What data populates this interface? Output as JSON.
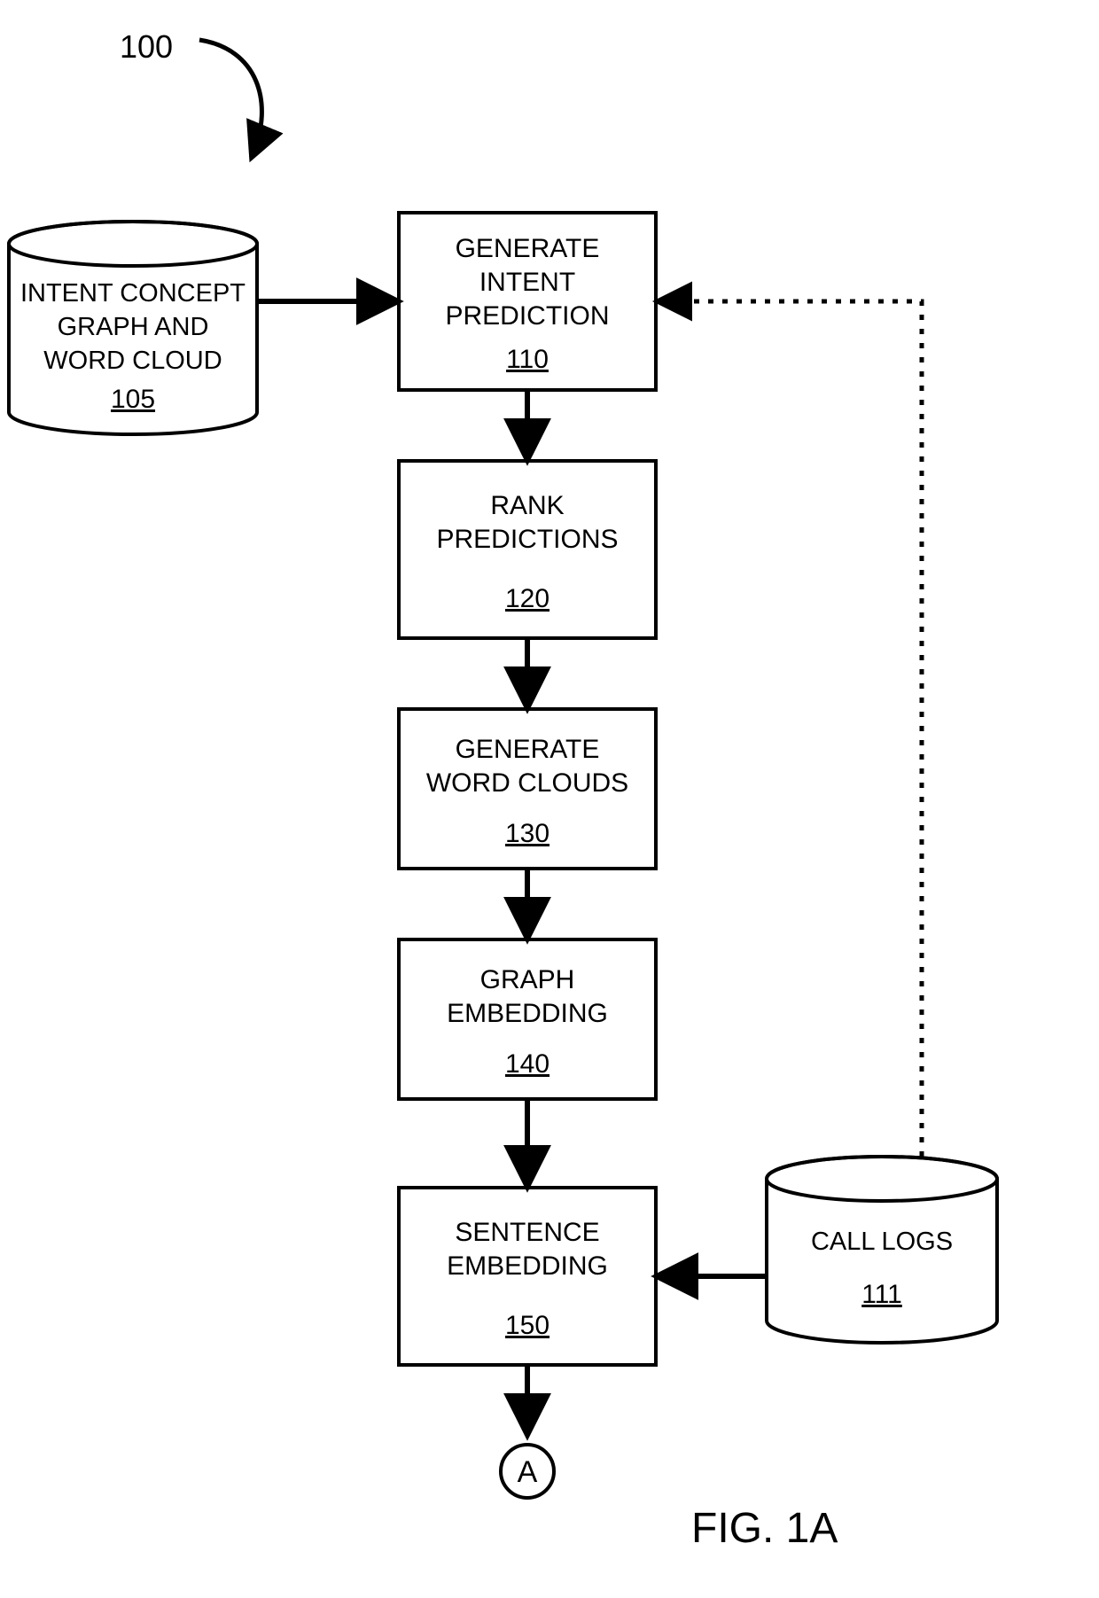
{
  "diagram": {
    "figure_label": "FIG. 1A",
    "pointer_label": "100",
    "off_page_connector": "A",
    "cylinders": {
      "intent_concept": {
        "line1": "INTENT CONCEPT",
        "line2": "GRAPH AND",
        "line3": "WORD CLOUD",
        "ref": "105"
      },
      "call_logs": {
        "line1": "CALL LOGS",
        "ref": "111"
      }
    },
    "boxes": {
      "b110": {
        "line1": "GENERATE",
        "line2": "INTENT",
        "line3": "PREDICTION",
        "ref": "110"
      },
      "b120": {
        "line1": "RANK",
        "line2": "PREDICTIONS",
        "ref": "120"
      },
      "b130": {
        "line1": "GENERATE",
        "line2": "WORD CLOUDS",
        "ref": "130"
      },
      "b140": {
        "line1": "GRAPH",
        "line2": "EMBEDDING",
        "ref": "140"
      },
      "b150": {
        "line1": "SENTENCE",
        "line2": "EMBEDDING",
        "ref": "150"
      }
    }
  }
}
